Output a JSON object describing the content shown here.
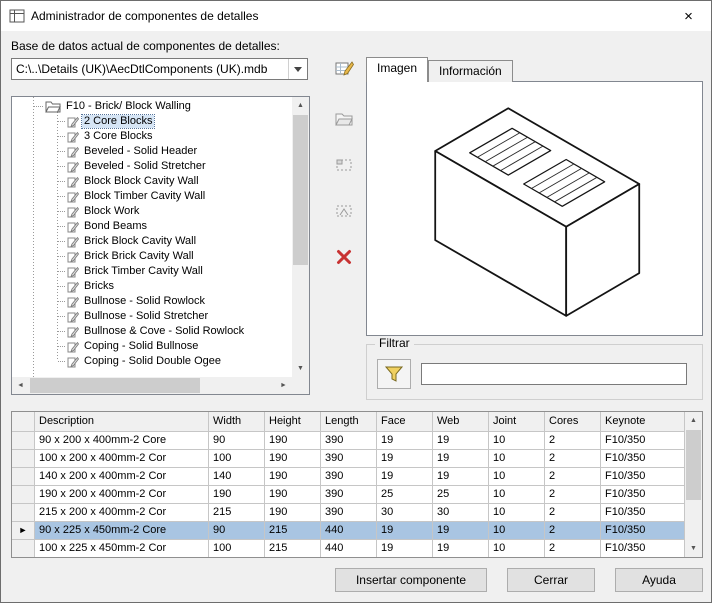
{
  "window": {
    "title": "Administrador de componentes de detalles"
  },
  "database": {
    "label": "Base de datos actual de componentes de detalles:",
    "path": "C:\\..\\Details (UK)\\AecDtlComponents (UK).mdb"
  },
  "tree": {
    "folder": "F10 - Brick/ Block Walling",
    "items": [
      {
        "label": "2 Core Blocks",
        "selected": true
      },
      {
        "label": "3 Core Blocks"
      },
      {
        "label": "Beveled - Solid Header"
      },
      {
        "label": "Beveled - Solid Stretcher"
      },
      {
        "label": "Block Block Cavity Wall"
      },
      {
        "label": "Block Timber Cavity Wall"
      },
      {
        "label": "Block Work"
      },
      {
        "label": "Bond Beams"
      },
      {
        "label": "Brick Block Cavity Wall"
      },
      {
        "label": "Brick Brick Cavity Wall"
      },
      {
        "label": "Brick Timber Cavity Wall"
      },
      {
        "label": "Bricks"
      },
      {
        "label": "Bullnose - Solid Rowlock"
      },
      {
        "label": "Bullnose - Solid Stretcher"
      },
      {
        "label": "Bullnose & Cove - Solid Rowlock"
      },
      {
        "label": "Coping - Solid Bullnose"
      },
      {
        "label": "Coping - Solid Double Ogee"
      }
    ]
  },
  "tabs": {
    "image": "Imagen",
    "info": "Información"
  },
  "filter": {
    "label": "Filtrar",
    "value": ""
  },
  "table": {
    "columns": [
      "Description",
      "Width",
      "Height",
      "Length",
      "Face",
      "Web",
      "Joint",
      "Cores",
      "Keynote"
    ],
    "rows": [
      {
        "selected": false,
        "cells": [
          "90 x 200 x 400mm-2 Core",
          "90",
          "190",
          "390",
          "19",
          "19",
          "10",
          "2",
          "F10/350"
        ]
      },
      {
        "selected": false,
        "cells": [
          "100 x 200 x 400mm-2 Cor",
          "100",
          "190",
          "390",
          "19",
          "19",
          "10",
          "2",
          "F10/350"
        ]
      },
      {
        "selected": false,
        "cells": [
          "140 x 200 x 400mm-2 Cor",
          "140",
          "190",
          "390",
          "19",
          "19",
          "10",
          "2",
          "F10/350"
        ]
      },
      {
        "selected": false,
        "cells": [
          "190 x 200 x 400mm-2 Cor",
          "190",
          "190",
          "390",
          "25",
          "25",
          "10",
          "2",
          "F10/350"
        ]
      },
      {
        "selected": false,
        "cells": [
          "215 x 200 x 400mm-2 Cor",
          "215",
          "190",
          "390",
          "30",
          "30",
          "10",
          "2",
          "F10/350"
        ]
      },
      {
        "selected": true,
        "cells": [
          "90 x 225 x 450mm-2 Core",
          "90",
          "215",
          "440",
          "19",
          "19",
          "10",
          "2",
          "F10/350"
        ]
      },
      {
        "selected": false,
        "cells": [
          "100 x 225 x 450mm-2 Cor",
          "100",
          "215",
          "440",
          "19",
          "19",
          "10",
          "2",
          "F10/350"
        ]
      }
    ]
  },
  "buttons": {
    "insert": "Insertar componente",
    "close": "Cerrar",
    "help": "Ayuda"
  },
  "icons": {
    "close": "×",
    "combo_dropdown": "triangle-down",
    "edit_components": "pencil-over-table",
    "open_component": "open-folder",
    "new_group": "dashed-box",
    "rename_group": "dashed-box-arrow",
    "delete_component": "red-x",
    "filter": "funnel",
    "current_row": "►",
    "tree_folder": "open-folder",
    "tree_leaf": "detail-component-pencil"
  },
  "colors": {
    "row_selection": "#a9c5e2",
    "tree_selection": "#d6e5f5",
    "delete_red": "#c83232",
    "funnel_yellow": "#f0d060"
  }
}
